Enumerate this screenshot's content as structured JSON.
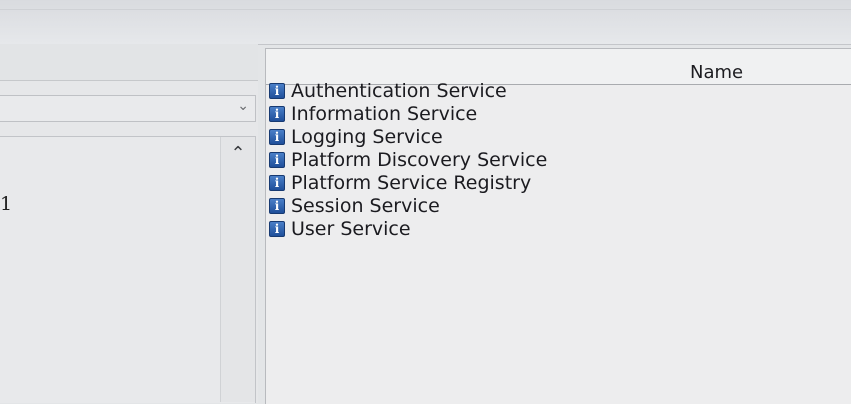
{
  "left_panel": {
    "dropdown": {
      "value": "",
      "chevron": "chevron-down-icon"
    },
    "list": {
      "visible_text": "1",
      "scroll_up_icon": "chevron-up-icon"
    }
  },
  "services_list": {
    "column_header": "Name",
    "item_icon": "info-icon",
    "items": [
      {
        "label": "Authentication Service"
      },
      {
        "label": "Information Service"
      },
      {
        "label": "Logging Service"
      },
      {
        "label": "Platform Discovery Service"
      },
      {
        "label": "Platform Service Registry"
      },
      {
        "label": "Session Service"
      },
      {
        "label": "User Service"
      }
    ]
  }
}
